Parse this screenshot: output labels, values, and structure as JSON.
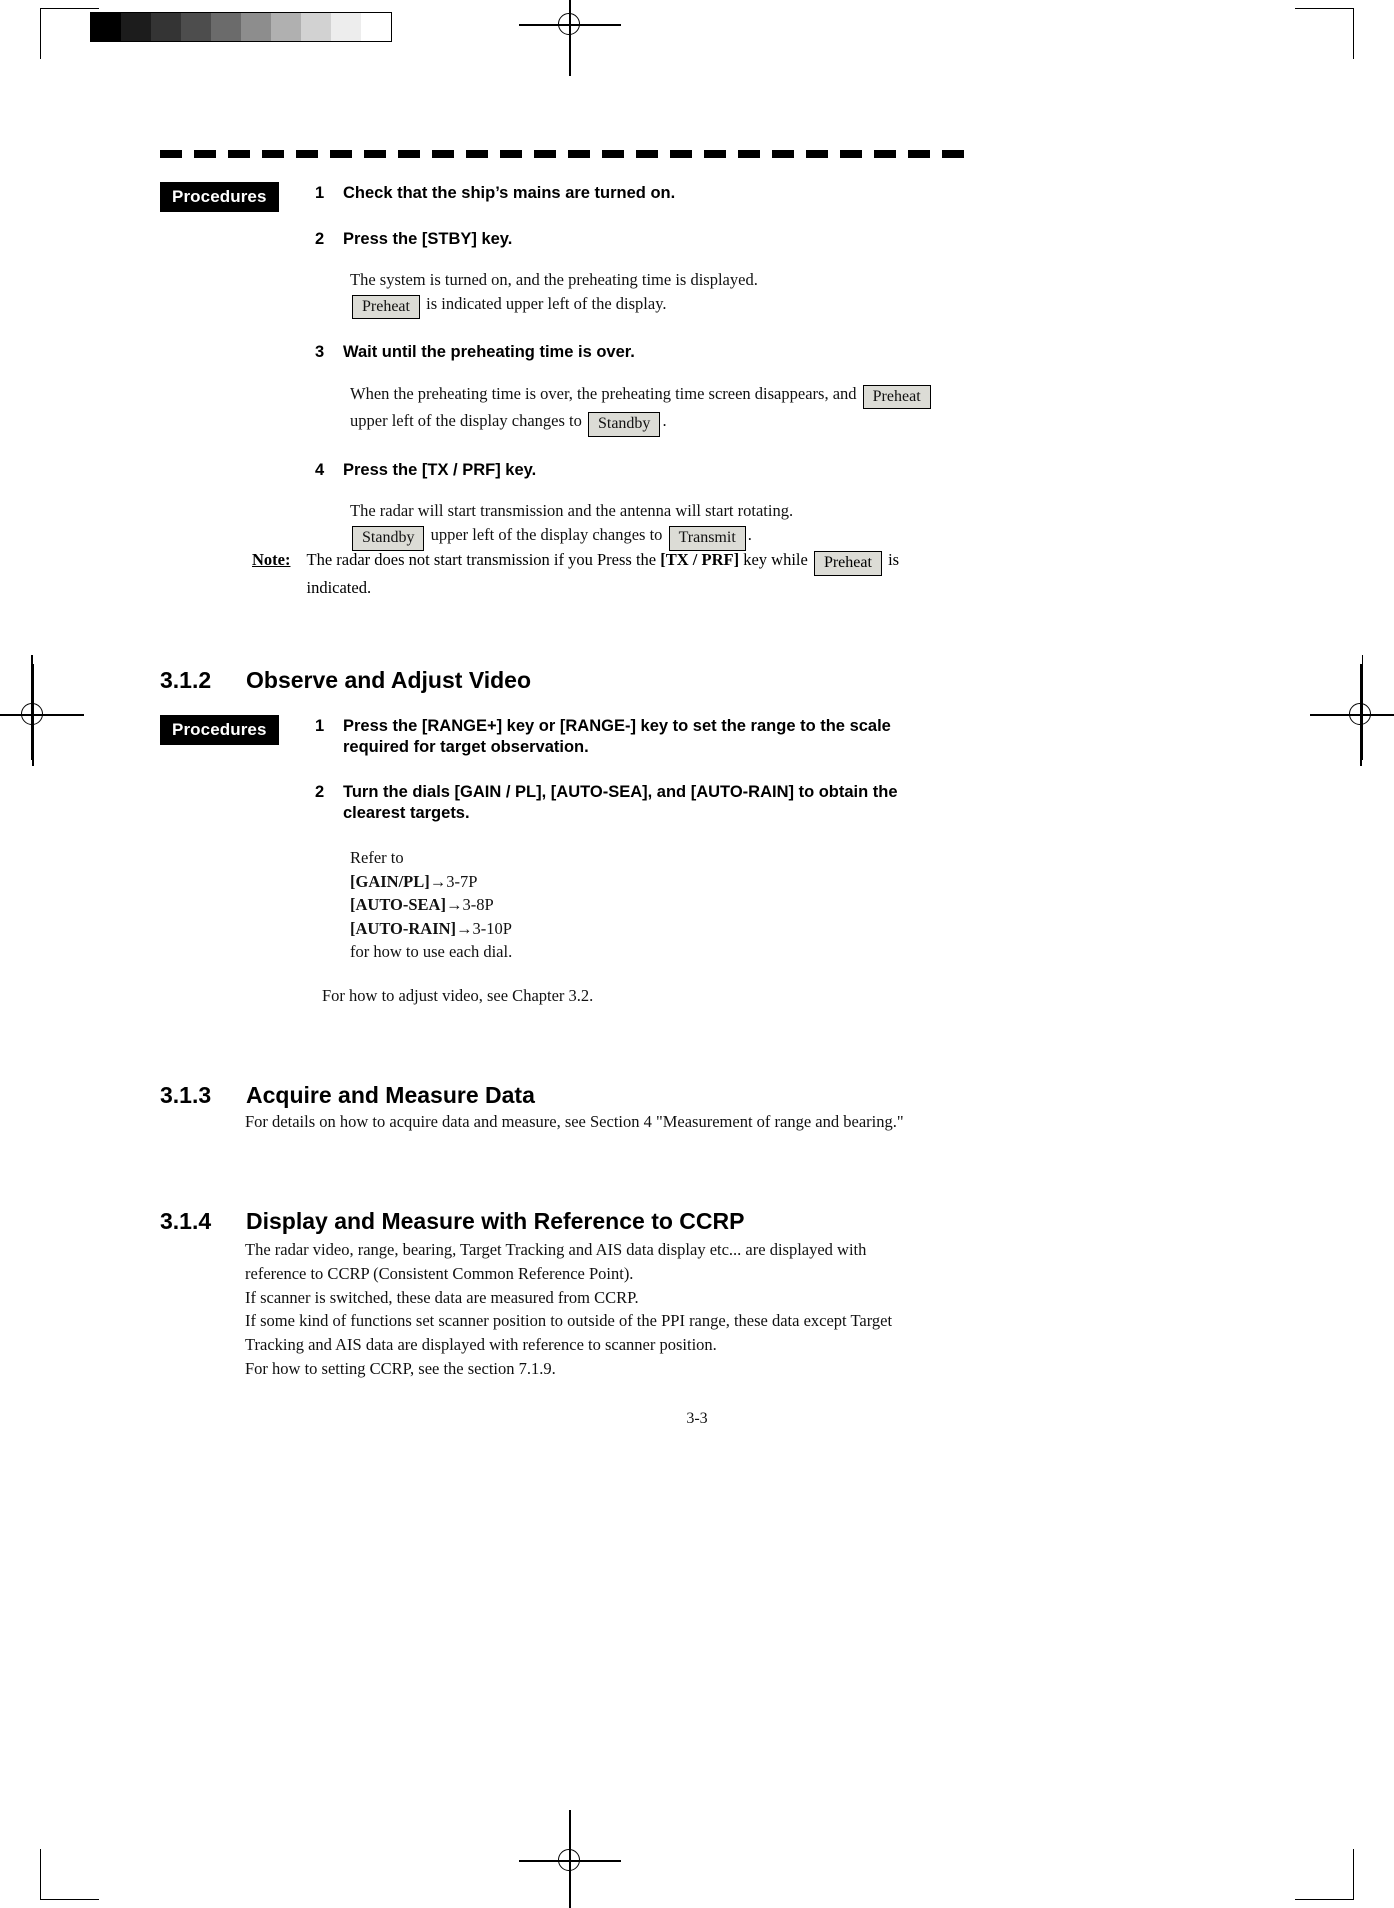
{
  "page": {
    "footer_page_number": "3-3",
    "grayscale_swatches": [
      "#000000",
      "#1c1c1c",
      "#343434",
      "#4d4d4d",
      "#6b6b6b",
      "#8d8d8d",
      "#b0b0b0",
      "#d2d2d2",
      "#ededed",
      "#ffffff"
    ],
    "indicator_fill": "#dcdcd6",
    "tag_background": "#000000",
    "tag_foreground": "#ffffff"
  },
  "section_311": {
    "procedures_tag": "Procedures",
    "steps": [
      {
        "num": "1",
        "title": "Check that the ship’s mains are turned on.",
        "body": []
      },
      {
        "num": "2",
        "title": "Press the [STBY] key.",
        "body": [
          {
            "pre": "The system is turned on, and the preheating time is displayed."
          },
          {
            "pre": "",
            "indicator": "Preheat",
            "post": "is indicated upper left of the display."
          }
        ]
      },
      {
        "num": "3",
        "title": "Wait until the preheating time is over.",
        "body": [
          {
            "pre": "When the preheating time is over, the preheating time screen disappears, and",
            "indicator": "Preheat",
            "post": ""
          },
          {
            "pre": "upper left of the display changes to",
            "indicator": "Standby",
            "post": "."
          }
        ]
      },
      {
        "num": "4",
        "title": "Press the [TX / PRF] key.",
        "body": [
          {
            "pre": "The radar will start transmission and the antenna will start rotating."
          },
          {
            "pre": "",
            "indicator": "Standby",
            "mid": "upper left of the display changes to",
            "indicator2": "Transmit",
            "post": "."
          }
        ]
      }
    ],
    "note": {
      "label": "Note:",
      "text_before_key": "The radar does not start transmission if you Press the ",
      "key": "[TX / PRF]",
      "text_after_key": " key while ",
      "indicator": "Preheat",
      "text_tail": "is",
      "text_line2": "indicated."
    }
  },
  "section_312": {
    "number": "3.1.2",
    "title": "Observe and Adjust Video",
    "procedures_tag": "Procedures",
    "steps": [
      {
        "num": "1",
        "title": "Press the [RANGE+] key or [RANGE-] key to set the range to the scale required for target observation.",
        "body": []
      },
      {
        "num": "2",
        "title": "Turn the dials [GAIN / PL], [AUTO-SEA], and [AUTO-RAIN] to obtain the clearest targets.",
        "body": []
      }
    ],
    "refer": {
      "intro": "Refer to",
      "entries": [
        {
          "key": "[GAIN/PL]",
          "arrow": "→",
          "target": "3-7P"
        },
        {
          "key": "[AUTO-SEA]",
          "arrow": "→",
          "target": "3-8P"
        },
        {
          "key": "[AUTO-RAIN]",
          "arrow": "→",
          "target": "3-10P"
        }
      ],
      "outro": "for how to use each dial."
    },
    "closing_note": "For how to adjust video, see Chapter 3.2."
  },
  "section_313": {
    "number": "3.1.3",
    "title": "Acquire and Measure Data",
    "paragraph": "For details on how to acquire data and measure, see Section 4 \"Measurement of range and bearing.\""
  },
  "section_314": {
    "number": "3.1.4",
    "title": "Display and Measure with Reference to CCRP",
    "paragraph_lines": [
      "The radar video, range, bearing, Target Tracking and AIS data display etc...    are displayed with",
      "reference to CCRP (Consistent Common Reference Point).",
      "If scanner is switched, these data are measured from CCRP.",
      "If some kind of functions set scanner position to outside of the PPI range, these data except Target",
      "Tracking and AIS data are displayed with reference to scanner position.",
      "For how to setting CCRP, see the section 7.1.9."
    ]
  }
}
